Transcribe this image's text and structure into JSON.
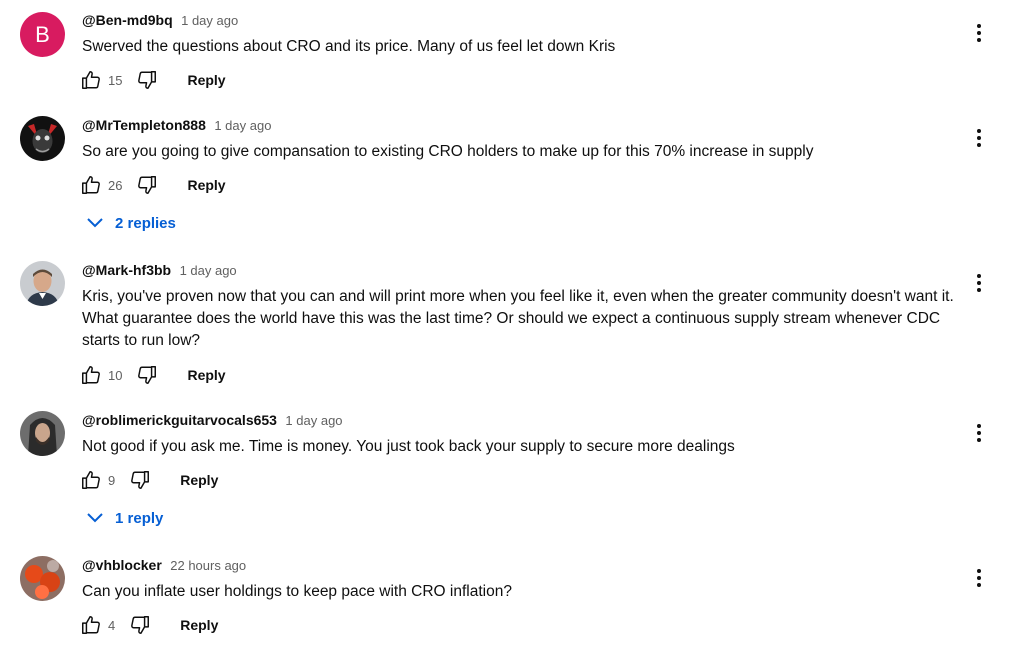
{
  "comments": [
    {
      "author": "@Ben-md9bq",
      "time": "1 day ago",
      "avatar_letter": "B",
      "text": "Swerved the questions about CRO and its price. Many of us feel let down Kris",
      "likes": "15",
      "reply_label": "Reply"
    },
    {
      "author": "@MrTempleton888",
      "time": "1 day ago",
      "text": "So are you going to give compansation to existing CRO holders to make up for this 70% increase in supply",
      "likes": "26",
      "reply_label": "Reply",
      "replies_label": "2 replies"
    },
    {
      "author": "@Mark-hf3bb",
      "time": "1 day ago",
      "text_lines": [
        "Kris, you've proven now that you can and will print more when you feel like it, even when the greater community doesn't want it.",
        "What guarantee does the world have this was the last time?  Or should we expect a continuous supply stream whenever CDC",
        "starts to run low?"
      ],
      "likes": "10",
      "reply_label": "Reply"
    },
    {
      "author": "@roblimerickguitarvocals653",
      "time": "1 day ago",
      "text": "Not good if you ask me. Time is money. You just took back your supply to  secure more dealings",
      "likes": "9",
      "reply_label": "Reply",
      "replies_label": "1 reply"
    },
    {
      "author": "@vhblocker",
      "time": "22 hours ago",
      "text": "Can you inflate user holdings to keep pace with CRO inflation?",
      "likes": "4",
      "reply_label": "Reply"
    }
  ],
  "colors": {
    "link_blue": "#065fd4",
    "avatar_b": "#d81b60",
    "meta_gray": "#606060"
  },
  "icons": [
    "thumb-up-icon",
    "thumb-down-icon",
    "more-vert-icon",
    "chevron-down-icon"
  ]
}
